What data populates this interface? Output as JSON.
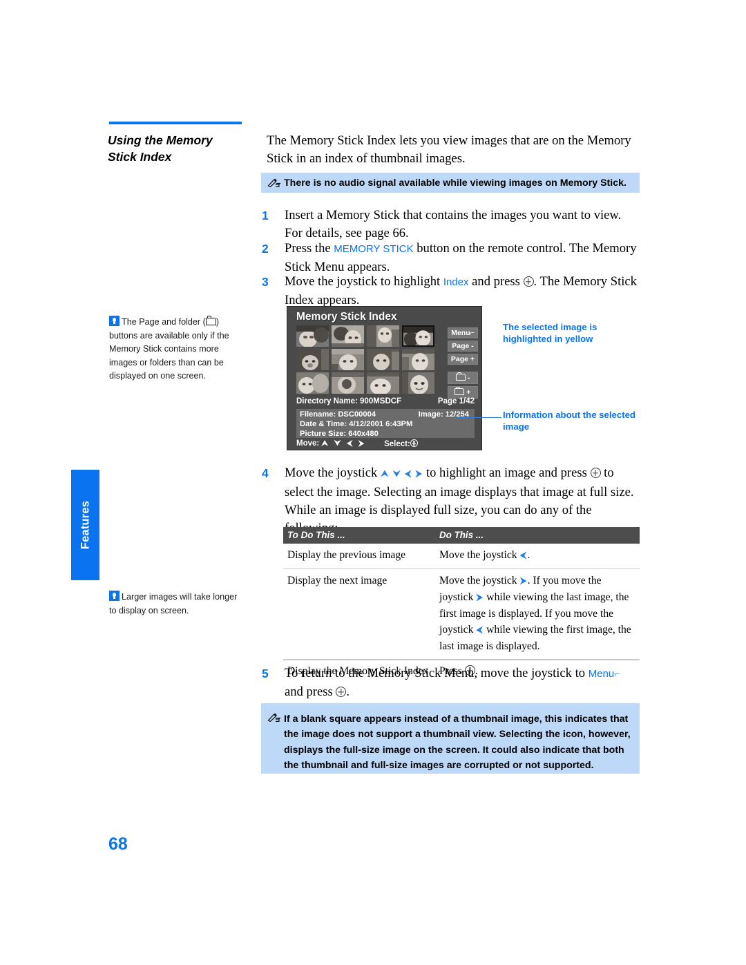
{
  "page_number": "68",
  "side_tab": {
    "label": "Features"
  },
  "heading": {
    "line1": "Using the Memory",
    "line2": "Stick Index",
    "rule_color": "#0a74f0"
  },
  "intro": "The Memory Stick Index lets you view images that are on the Memory Stick in an index of thumbnail images.",
  "note_top": "There is no audio signal available while viewing images on Memory Stick.",
  "note_bottom": "If a blank square appears instead of a thumbnail image, this indicates that the image does not support a thumbnail view. Selecting the icon, however, displays the full-size image on the screen. It could also indicate that both the thumbnail and full-size images are corrupted or not supported.",
  "steps": [
    {
      "num": "1",
      "part_a": "Insert a Memory Stick that contains the images you want to view. For details, see page 66.",
      "part_b": "",
      "part_c": ""
    },
    {
      "num": "2",
      "part_a": "Press the ",
      "highlight": "MEMORY STICK",
      "part_b": " button on the remote control. The Memory Stick Menu appears.",
      "part_c": ""
    },
    {
      "num": "3",
      "part_a": "Move the joystick to highlight ",
      "highlight": "Index",
      "part_b": " and press ",
      "part_c": ". The Memory Stick Index appears."
    },
    {
      "num": "4",
      "part_a": "Move the joystick ",
      "arrows": "⮝ ⮟ ⮜ ⮞",
      "part_b": " to highlight an image and press ",
      "part_c": " to select the image. Selecting an image displays that image at full size. While an image is displayed full size, you can do any of the following:"
    },
    {
      "num": "5",
      "part_a": "To return to the Memory Stick Menu, move the joystick to ",
      "highlight": "Menu",
      "arrow_glyph": "⌐",
      "part_b": " and press ",
      "part_c": "."
    }
  ],
  "tip_notes": [
    {
      "text_a": "The Page and folder (",
      "text_b": ") buttons are available only if the Memory Stick contains more images or folders than can be displayed on one screen."
    },
    {
      "text_a": "Larger images will take longer to display on screen.",
      "text_b": ""
    }
  ],
  "tv_screen": {
    "title": "Memory Stick Index",
    "buttons": [
      {
        "label": "Menu",
        "glyph": "⌐",
        "type": "menu"
      },
      {
        "label": "Page -",
        "glyph": "",
        "type": "page"
      },
      {
        "label": "Page +",
        "glyph": "",
        "type": "page"
      },
      {
        "label": "-",
        "glyph": "folder",
        "type": "folder"
      },
      {
        "label": "+",
        "glyph": "folder",
        "type": "folder"
      }
    ],
    "directory_label": "Directory Name: 900MSDCF",
    "page_label": "Page 1/42",
    "filename": "Filename: DSC00004",
    "image_count": "Image: 12/254",
    "datetime": "Date & Time: 4/12/2001 6:43PM",
    "picture_size": "Picture Size: 640x480",
    "move_label": "Move:",
    "move_arrows": "⮝ ⮟ ⮜ ⮞",
    "select_label": "Select:",
    "selected_index": 3,
    "thumbnail_count": 12
  },
  "callouts": {
    "selected": "The selected image is highlighted in yellow",
    "info": "Information about the selected image"
  },
  "table": {
    "headers": [
      "To Do This ...",
      "Do This ..."
    ],
    "rows": [
      {
        "col1": "Display the previous image",
        "col2_a": "Move the joystick ",
        "col2_arrow1": "⮜",
        "col2_b": ".",
        "col2_arrow2": "",
        "col2_c": "",
        "col2_arrow3": "",
        "col2_d": ""
      },
      {
        "col1": "Display the next image",
        "col2_a": "Move the joystick ",
        "col2_arrow1": "⮞",
        "col2_b": ". If you move the joystick ",
        "col2_arrow2": "⮞",
        "col2_c": " while viewing the last image, the first image is displayed. If you move the joystick ",
        "col2_arrow3": "⮜",
        "col2_d": " while viewing the first image, the last image is displayed."
      },
      {
        "col1": "Display the Memory Stick Index",
        "col2_a": "Press ",
        "col2_arrow1": "",
        "col2_b": ".",
        "col2_arrow2": "",
        "col2_c": "",
        "col2_arrow3": "",
        "col2_d": ""
      }
    ]
  },
  "colors": {
    "accent_blue": "#0a74f0",
    "note_bg": "#bed9f7",
    "table_header_bg": "#4d4d4d",
    "tv_bg": "#4a4a4a"
  }
}
